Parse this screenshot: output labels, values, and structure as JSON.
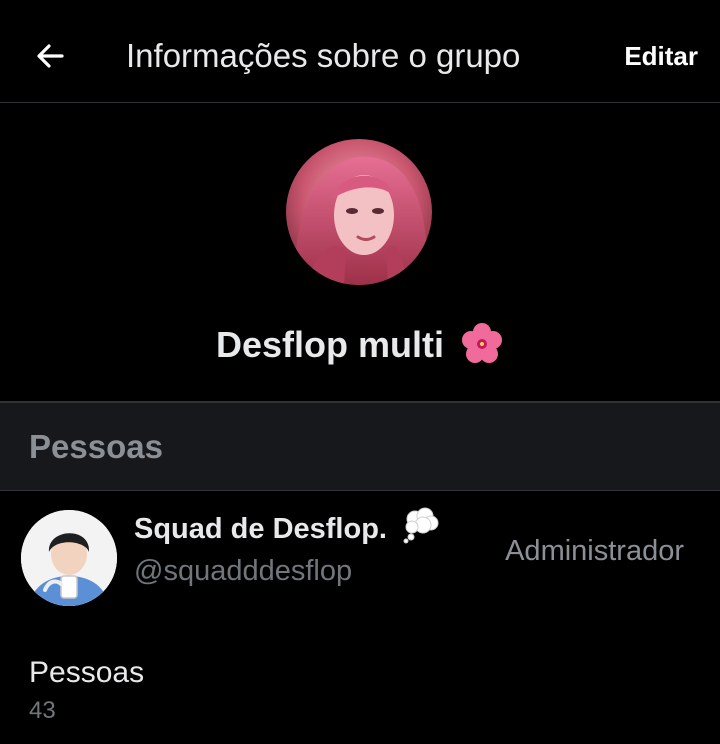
{
  "topbar": {
    "back_icon": "arrow-left-icon",
    "title": "Informações sobre o grupo",
    "edit_label": "Editar"
  },
  "group": {
    "name": "Desflop multi",
    "emoji_icon": "hibiscus-icon"
  },
  "people_section": {
    "title": "Pessoas"
  },
  "members": [
    {
      "name": "Squad de Desflop.",
      "emoji_icon": "thought-bubble-icon",
      "handle": "@squadddesflop",
      "role": "Administrador"
    }
  ],
  "people_count": {
    "label": "Pessoas",
    "value": "43"
  },
  "colors": {
    "background": "#000000",
    "section_background": "#16181c",
    "divider": "#2f3336",
    "primary_text": "#e7e9ea",
    "secondary_text": "#71767b",
    "accent_pink": "#e0508c"
  }
}
